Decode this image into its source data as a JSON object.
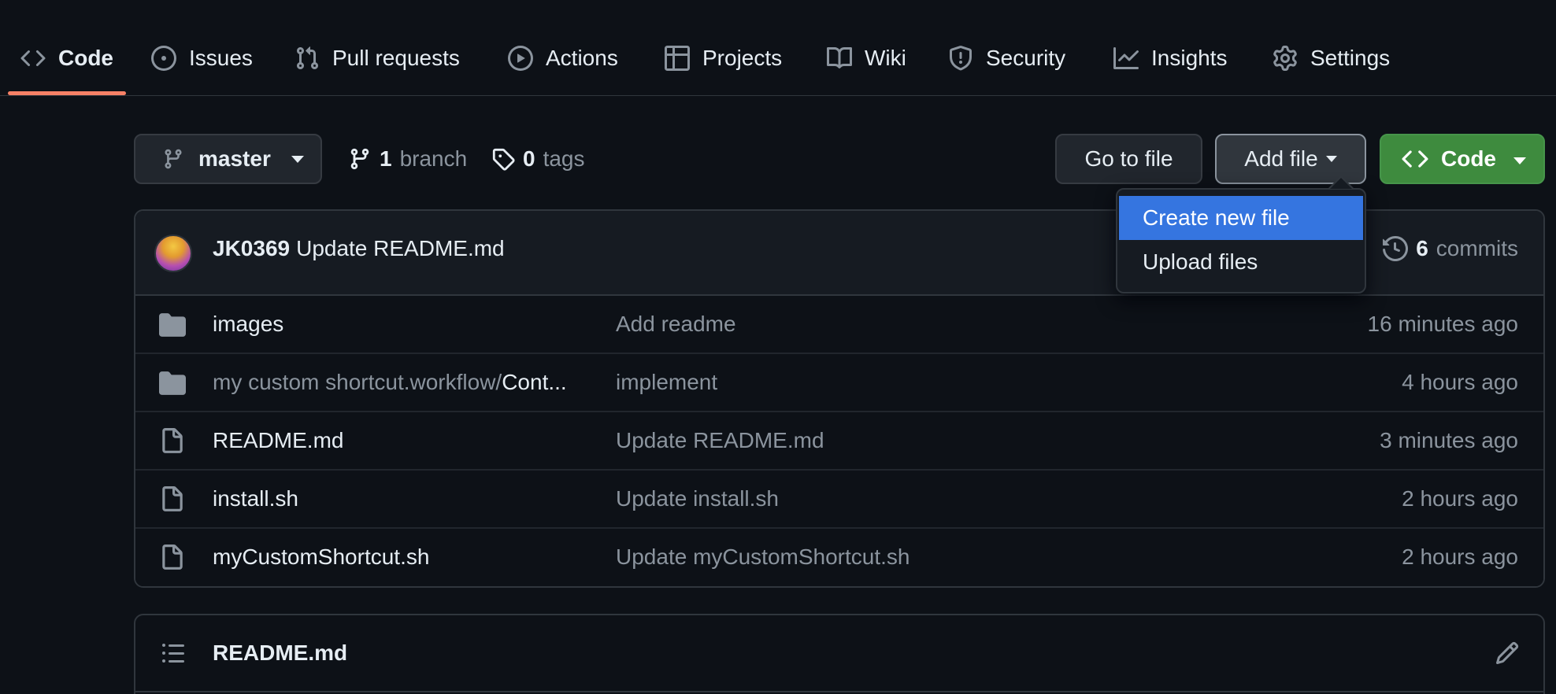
{
  "nav": {
    "tabs": [
      {
        "label": "Code",
        "icon": "code-icon",
        "active": true
      },
      {
        "label": "Issues",
        "icon": "issue-circle-icon"
      },
      {
        "label": "Pull requests",
        "icon": "pull-request-icon"
      },
      {
        "label": "Actions",
        "icon": "play-icon"
      },
      {
        "label": "Projects",
        "icon": "table-icon"
      },
      {
        "label": "Wiki",
        "icon": "book-icon"
      },
      {
        "label": "Security",
        "icon": "shield-icon"
      },
      {
        "label": "Insights",
        "icon": "graph-icon"
      },
      {
        "label": "Settings",
        "icon": "gear-icon"
      }
    ],
    "active_color": "#f78166"
  },
  "branch_bar": {
    "branch_name": "master",
    "branch_count": "1",
    "branch_label": "branch",
    "tag_count": "0",
    "tag_label": "tags",
    "go_to_file": "Go to file",
    "add_file": "Add file",
    "code_button": "Code",
    "code_button_color": "#3e8b3e"
  },
  "add_file_menu": {
    "items": [
      "Create new file",
      "Upload files"
    ],
    "selected_color": "#3575e0"
  },
  "latest_commit": {
    "author": "JK0369",
    "message": "Update README.md",
    "commit_count": "6",
    "commit_label": "commits"
  },
  "files": [
    {
      "type": "folder",
      "name": "images",
      "message": "Add readme",
      "age": "16 minutes ago"
    },
    {
      "type": "folder",
      "name_prefix": "my custom shortcut.workflow/",
      "name": "Cont...",
      "message": "implement",
      "age": "4 hours ago"
    },
    {
      "type": "file",
      "name": "README.md",
      "message": "Update README.md",
      "age": "3 minutes ago"
    },
    {
      "type": "file",
      "name": "install.sh",
      "message": "Update install.sh",
      "age": "2 hours ago"
    },
    {
      "type": "file",
      "name": "myCustomShortcut.sh",
      "message": "Update myCustomShortcut.sh",
      "age": "2 hours ago"
    }
  ],
  "readme": {
    "title": "README.md"
  }
}
